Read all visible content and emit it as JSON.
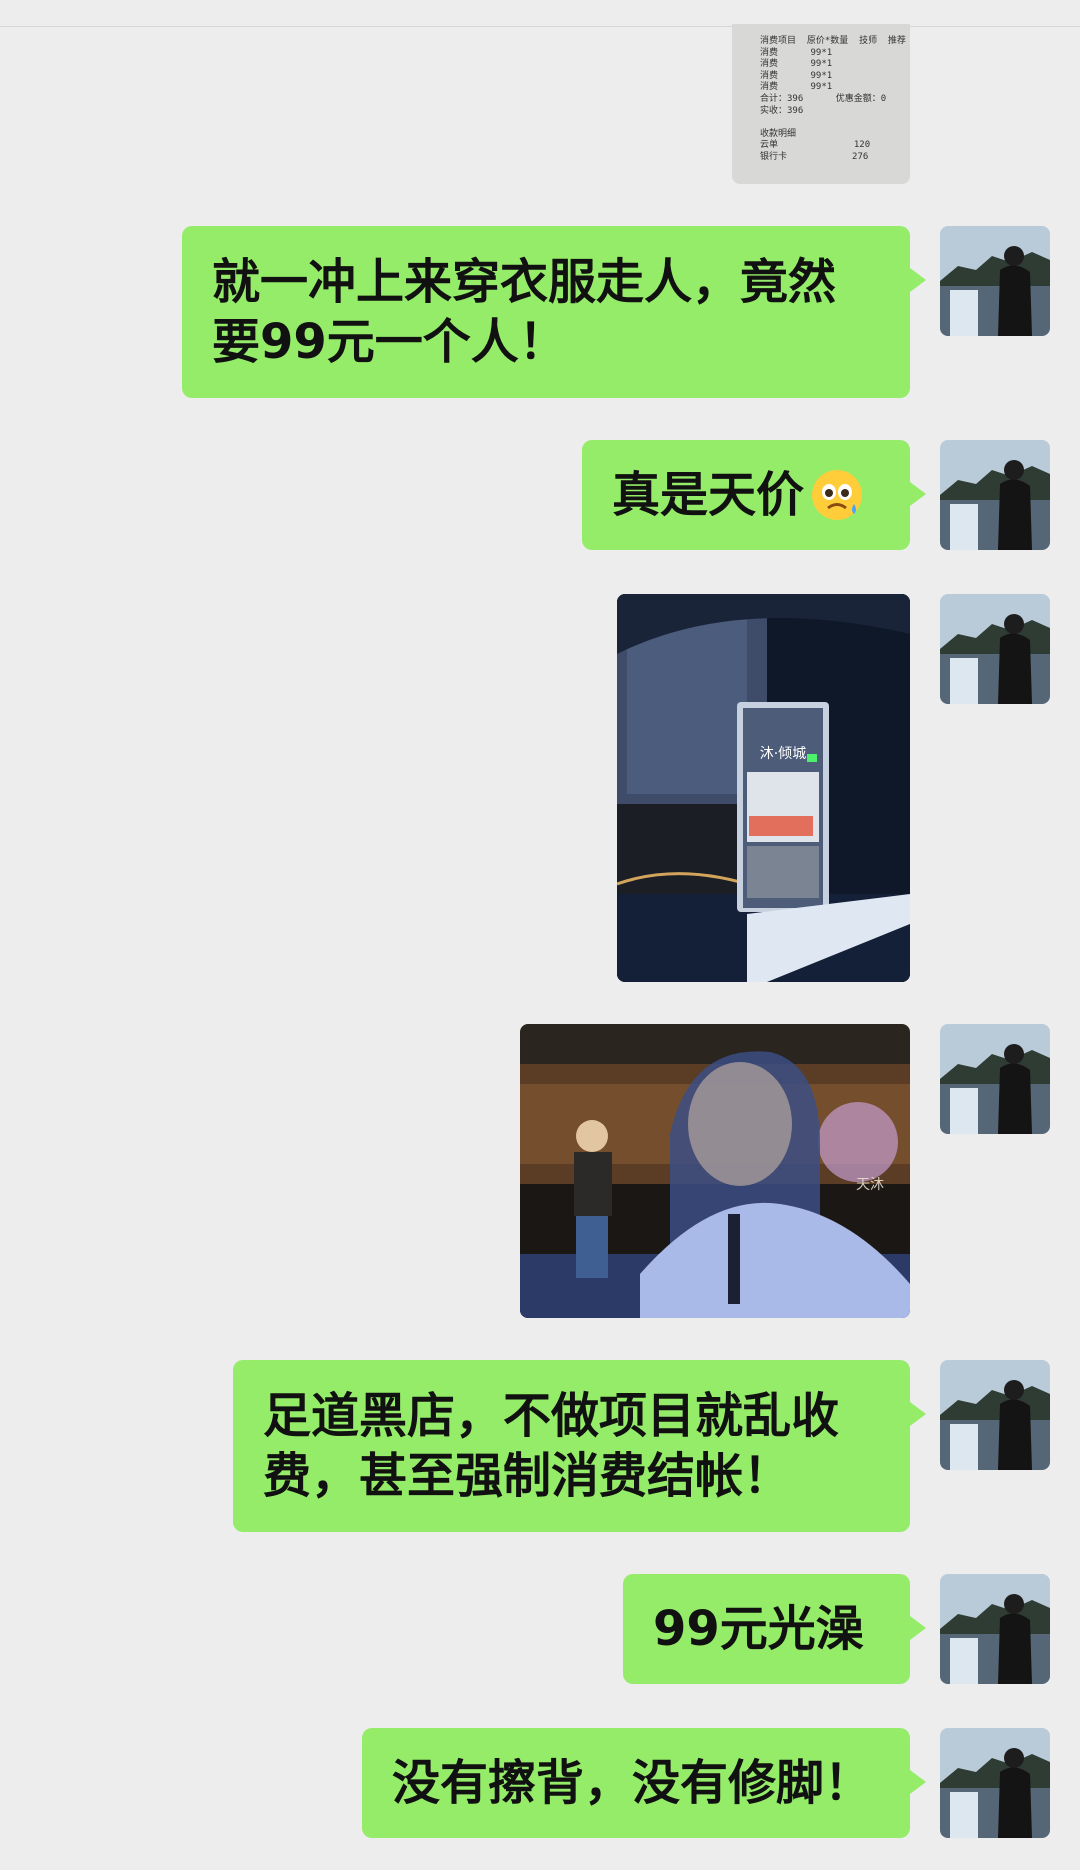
{
  "receipt": {
    "lines": [
      "消费项目  原价*数量  技师  推荐",
      "消费      99*1",
      "消费      99*1",
      "消费      99*1",
      "消费      99*1",
      "合计：396      优惠金额：0",
      "实收：396",
      "",
      "收款明细",
      "云单              120",
      "银行卡            276"
    ]
  },
  "messages": [
    {
      "type": "text",
      "text": "就一冲上来穿衣服走人，竟然\n要99元一个人！"
    },
    {
      "type": "text",
      "text": "真是天价",
      "emoji": "anxious-face-emoji"
    },
    {
      "type": "image",
      "sign_text": [
        "沐·倾城"
      ]
    },
    {
      "type": "image",
      "sign_text": [
        "天沐"
      ]
    },
    {
      "type": "text",
      "text": "足道黑店，不做项目就乱收\n费，甚至强制消费结帐！"
    },
    {
      "type": "text",
      "text": "99元光澡"
    },
    {
      "type": "text",
      "text": "没有擦背，没有修脚！"
    }
  ],
  "colors": {
    "background": "#ededed",
    "bubble": "#95ec69",
    "text": "#111111"
  }
}
